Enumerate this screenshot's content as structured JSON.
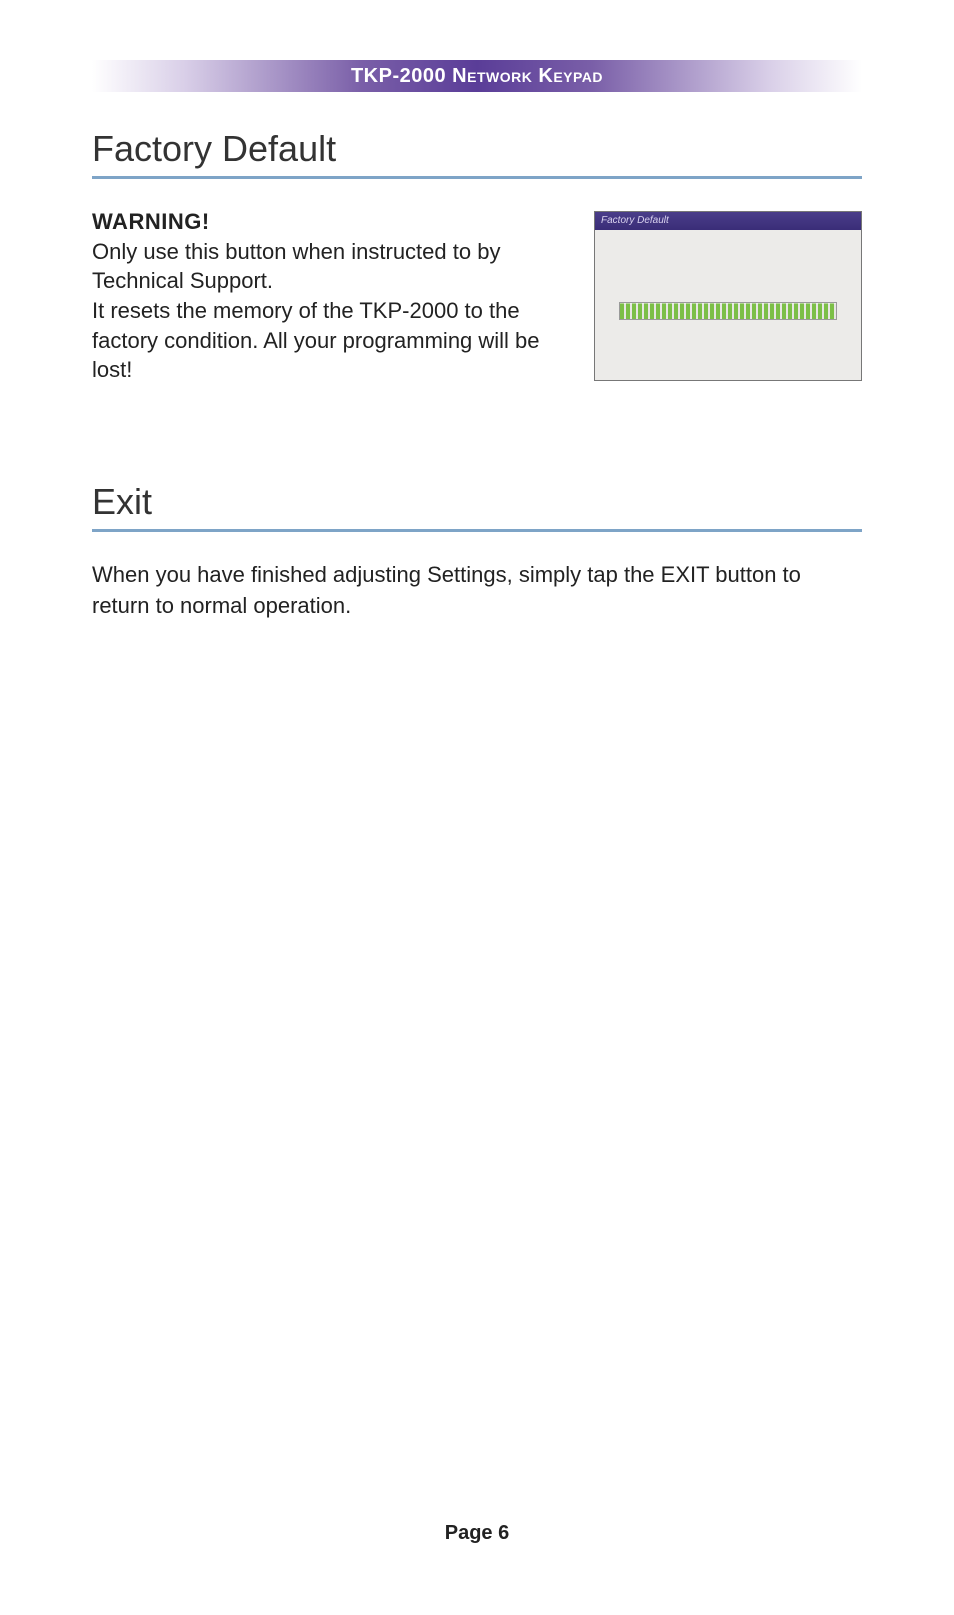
{
  "header": {
    "title": "TKP-2000 Network Keypad"
  },
  "sections": {
    "factory_default": {
      "title": "Factory Default",
      "warning_label": "WARNING!",
      "para1": "Only use this button when instructed to by Technical Support.",
      "para2": "It resets the memory of the TKP-2000 to the factory condition. All your programming will be lost!",
      "figure": {
        "titlebar": "Factory Default"
      }
    },
    "exit": {
      "title": "Exit",
      "para": "When you have finished adjusting Settings, simply tap the EXIT button to return to normal operation."
    }
  },
  "footer": {
    "page_label": "Page 6"
  }
}
